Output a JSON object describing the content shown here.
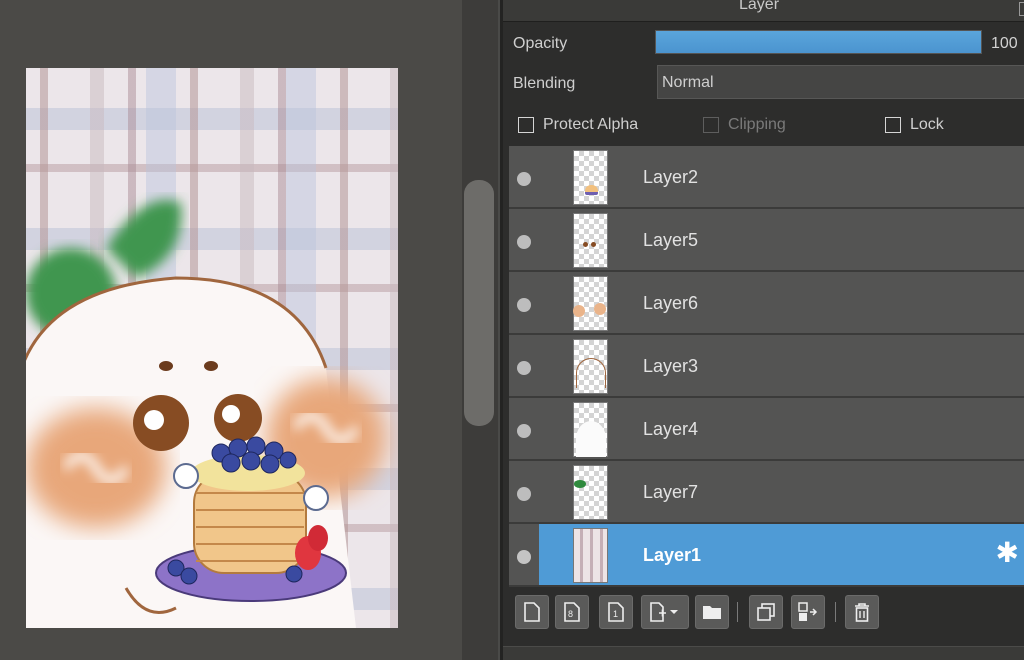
{
  "panel": {
    "title": "Layer",
    "opacity_label": "Opacity",
    "opacity_value": "100",
    "opacity_fraction": 1.0,
    "blending_label": "Blending",
    "blending_value": "Normal",
    "checkboxes": {
      "protect_alpha": "Protect Alpha",
      "clipping": "Clipping",
      "lock": "Lock"
    }
  },
  "layers": [
    {
      "name": "Layer2",
      "selected": false
    },
    {
      "name": "Layer5",
      "selected": false
    },
    {
      "name": "Layer6",
      "selected": false
    },
    {
      "name": "Layer3",
      "selected": false
    },
    {
      "name": "Layer4",
      "selected": false
    },
    {
      "name": "Layer7",
      "selected": false
    },
    {
      "name": "Layer1",
      "selected": true
    }
  ],
  "toolbar": {
    "icons": [
      "new-layer-icon",
      "new-layer-8bit-icon",
      "new-layer-1bit-icon",
      "add-layer-menu-icon",
      "folder-icon",
      "duplicate-layer-icon",
      "merge-down-icon",
      "delete-layer-icon"
    ]
  },
  "colors": {
    "accent": "#4f9bd6",
    "panel_bg": "#2d2d2c",
    "layer_bg": "#545453"
  }
}
